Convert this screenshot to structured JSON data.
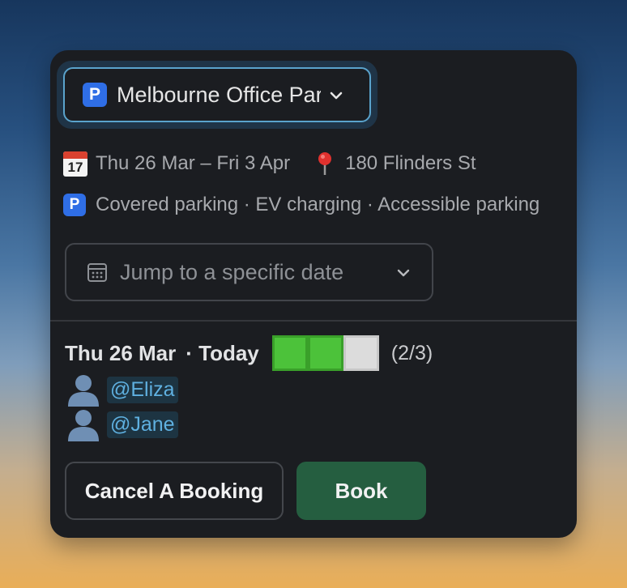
{
  "background": {
    "gradient_top": "#17365d",
    "gradient_bottom": "#e9ae58"
  },
  "office_select": {
    "icon": "parking-icon",
    "icon_letter": "P",
    "value": "Melbourne Office Parking",
    "accent_color": "#5aa3cc"
  },
  "details": {
    "date_range": "Thu 26 Mar – Fri 3 Apr",
    "calendar_icon_day": "17",
    "address": "180 Flinders St",
    "features": "Covered parking · EV charging · Accessible parking",
    "feature_icon_letter": "P"
  },
  "date_picker": {
    "placeholder": "Jump to a specific date"
  },
  "day": {
    "date": "Thu 26 Mar",
    "today_label": "· Today",
    "capacity": {
      "booked": 2,
      "total": 3
    },
    "count_text": "(2/3)",
    "full_color": "#4cc23a",
    "empty_color": "#dcdcdc",
    "bookings": [
      {
        "user": "@Eliza"
      },
      {
        "user": "@Jane"
      }
    ]
  },
  "actions": {
    "cancel_label": "Cancel A Booking",
    "book_label": "Book",
    "book_color": "#255e40"
  }
}
